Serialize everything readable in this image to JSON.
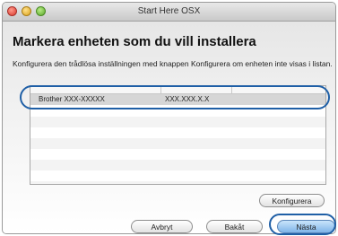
{
  "window": {
    "title": "Start Here OSX"
  },
  "main": {
    "heading": "Markera enheten som du vill installera",
    "description": "Konfigurera den trådlösa inställningen med knappen Konfigurera om enheten inte visas i listan."
  },
  "device_list": {
    "rows": [
      {
        "name": "Brother XXX-XXXXX",
        "address": "XXX.XXX.X.X"
      }
    ],
    "selected_index": 0
  },
  "buttons": {
    "configure": "Konfigurera",
    "cancel": "Avbryt",
    "back": "Bakåt",
    "next": "Nästa"
  },
  "colors": {
    "highlight": "#1f5fa6",
    "selected_row": "#d6d6d6"
  }
}
